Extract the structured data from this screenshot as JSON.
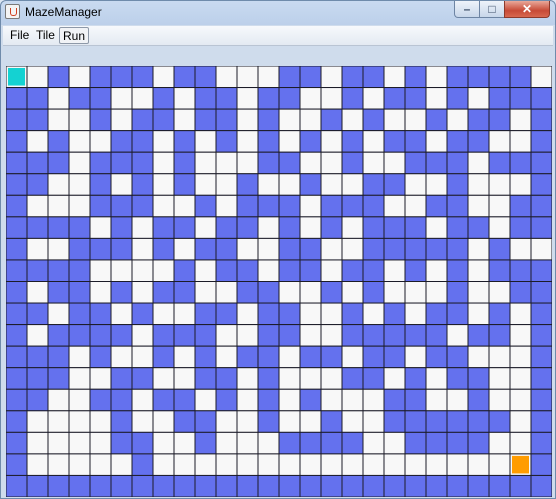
{
  "window": {
    "title": "MazeManager",
    "controls": {
      "minimize_icon": "minimize-icon",
      "maximize_icon": "maximize-icon",
      "close_icon": "close-icon"
    }
  },
  "menu": {
    "items": [
      {
        "label": "File"
      },
      {
        "label": "Tile"
      },
      {
        "label": "Run"
      }
    ]
  },
  "maze": {
    "rows": 20,
    "cols": 26,
    "colors": {
      "wall": "#6471ee",
      "path": "#f8f8f8",
      "start": "#14d2d2",
      "goal": "#ff9c00",
      "grid": "#1c1c28"
    },
    "start": {
      "row": 0,
      "col": 0
    },
    "goal": {
      "row": 18,
      "col": 24
    },
    "grid": [
      "10101110110001101101011110",
      "11011001011011001011010111",
      "11001011011010010100101101",
      "10100110101010101011011001",
      "11101110100011001001110111",
      "11001010100100100110010001",
      "10001110010111011100110011",
      "11110101101101010111011011",
      "10011101011001100111110100",
      "11110000101101101101010111",
      "10110101100110010100010011",
      "11011010011011001010110101",
      "10111101110011001111101101",
      "11101001010110110110110001",
      "11100110011010001101011001",
      "11001101101010100011001001",
      "10000100110010010011111101",
      "10000110010001111001111001",
      "10000010000000000000000001",
      "11111111111111111111111111"
    ]
  }
}
